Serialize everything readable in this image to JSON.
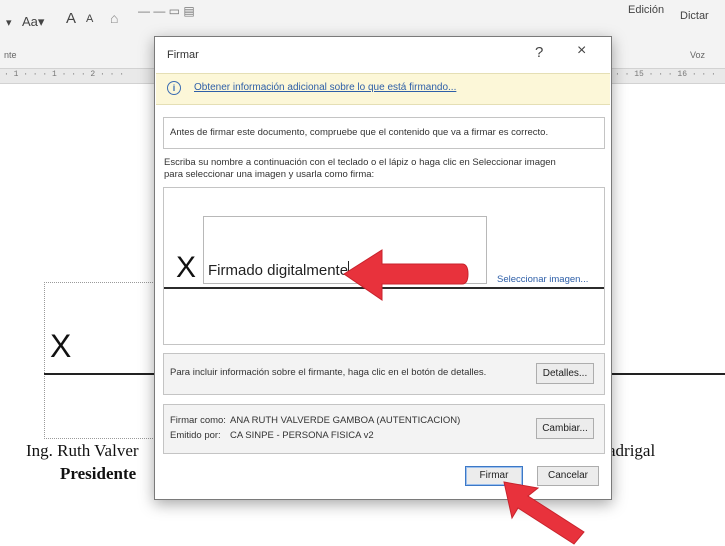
{
  "ribbon": {
    "font_size_label": "Aa",
    "grow_font": "A",
    "shrink_font": "A",
    "paragraph_group": "nte",
    "edit_label": "Edición",
    "dictate_label": "Dictar",
    "voice_group": "Voz"
  },
  "ruler": {
    "left_ticks": "· 1 · · · 1 · · · 2 · · ·",
    "right_ticks": "· · 15 · · · 16 · · ·"
  },
  "document": {
    "x_mark": "X",
    "name_left": "Ing. Ruth Valver",
    "role": "Presidente",
    "name_right": "adrigal"
  },
  "dialog": {
    "title": "Firmar",
    "help": "?",
    "close": "×",
    "info_icon": "i",
    "info_link": "Obtener información adicional sobre lo que está firmando...",
    "notice": "Antes de firmar este documento, compruebe que el contenido que va a firmar es correcto.",
    "instructions_line1": "Escriba su nombre a continuación con el teclado o el lápiz o haga clic en Seleccionar imagen",
    "instructions_line2": "para seleccionar una imagen y usarla como firma:",
    "signature_x": "X",
    "signature_value": "Firmado digitalmente",
    "select_image": "Seleccionar imagen...",
    "details_text": "Para incluir información sobre el firmante, haga clic en el botón de detalles.",
    "details_button": "Detalles...",
    "sign_as_label": "Firmar como:",
    "sign_as_value": "ANA RUTH VALVERDE GAMBOA (AUTENTICACION)",
    "issued_by_label": "Emitido por:",
    "issued_by_value": "CA SINPE - PERSONA FISICA v2",
    "change_button": "Cambiar...",
    "sign_button": "Firmar",
    "cancel_button": "Cancelar"
  },
  "colors": {
    "annotation_arrow": "#e8323c",
    "link": "#2e5fa8",
    "info_bar": "#fcf7d8"
  }
}
